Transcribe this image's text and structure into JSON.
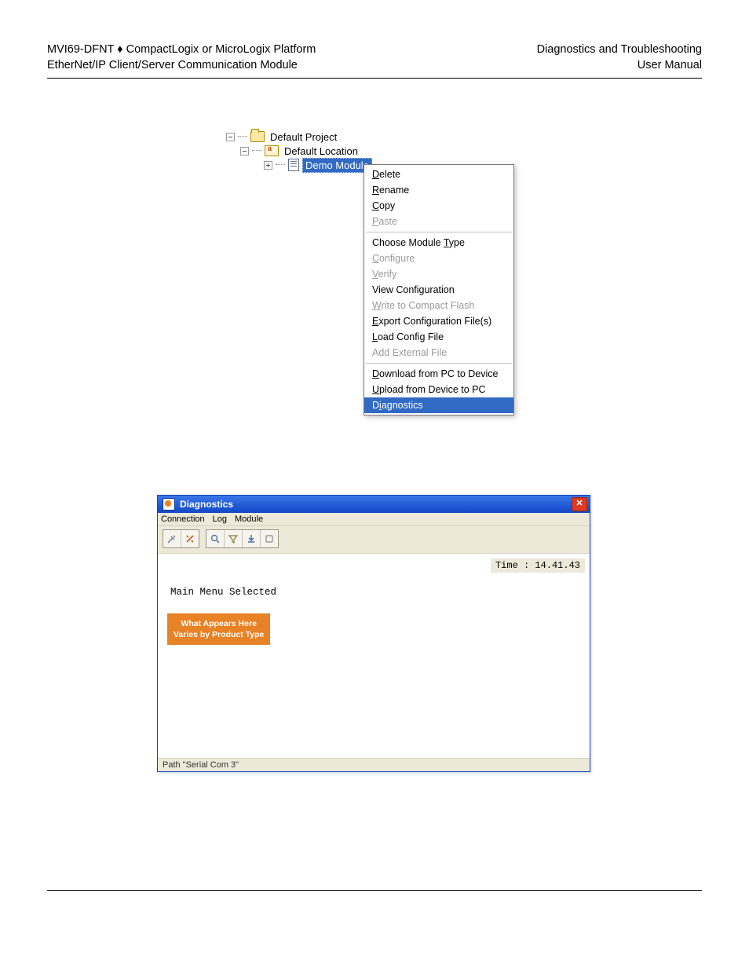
{
  "header": {
    "left_line1_prefix": "MVI69-DFNT ",
    "left_line1_sep": "♦",
    "left_line1_suffix": " CompactLogix or MicroLogix Platform",
    "left_line2": "EtherNet/IP Client/Server Communication Module",
    "right_line1": "Diagnostics and Troubleshooting",
    "right_line2": "User Manual"
  },
  "tree": {
    "root": "Default Project",
    "loc": "Default Location",
    "module": "Demo Module"
  },
  "context_menu": {
    "groups": [
      [
        {
          "label": "Delete",
          "disabled": false,
          "ul_index": 0
        },
        {
          "label": "Rename",
          "disabled": false,
          "ul_index": 0
        },
        {
          "label": "Copy",
          "disabled": false,
          "ul_index": 0
        },
        {
          "label": "Paste",
          "disabled": true,
          "ul_index": 0
        }
      ],
      [
        {
          "label": "Choose Module Type",
          "disabled": false,
          "ul_index": 14
        },
        {
          "label": "Configure",
          "disabled": true,
          "ul_index": 0
        },
        {
          "label": "Verify",
          "disabled": true,
          "ul_index": 0
        },
        {
          "label": "View Configuration",
          "disabled": false,
          "ul_index": -1
        },
        {
          "label": "Write to Compact Flash",
          "disabled": true,
          "ul_index": 0
        },
        {
          "label": "Export Configuration File(s)",
          "disabled": false,
          "ul_index": 0
        },
        {
          "label": "Load Config File",
          "disabled": false,
          "ul_index": 0
        },
        {
          "label": "Add External File",
          "disabled": true,
          "ul_index": -1
        }
      ],
      [
        {
          "label": "Download from PC to Device",
          "disabled": false,
          "ul_index": 0
        },
        {
          "label": "Upload from Device to PC",
          "disabled": false,
          "ul_index": 0
        },
        {
          "label": "Diagnostics",
          "disabled": false,
          "ul_index": 1,
          "highlight": true
        }
      ]
    ]
  },
  "diag": {
    "title": "Diagnostics",
    "menus": [
      "Connection",
      "Log",
      "Module"
    ],
    "time_label": "Time : 14.41.43",
    "term_line": "Main Menu Selected",
    "callout_line1": "What Appears Here",
    "callout_line2": "Varies by Product Type",
    "status": "Path \"Serial Com 3\""
  },
  "toolbar_icons": {
    "g1": [
      "connect-icon",
      "disconnect-icon"
    ],
    "g2": [
      "magnify-icon",
      "filter-icon",
      "download-icon",
      "clear-icon"
    ]
  }
}
